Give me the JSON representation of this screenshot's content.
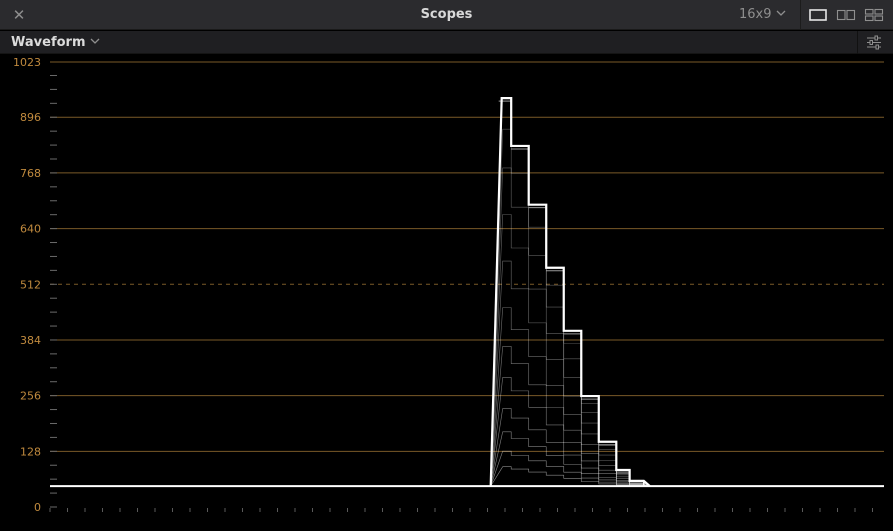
{
  "titlebar": {
    "title": "Scopes",
    "aspect_ratio": "16x9",
    "close_icon": "close-icon",
    "layout_options": [
      "single-view-icon",
      "dual-view-icon",
      "quad-view-icon"
    ]
  },
  "toolbar": {
    "scope_type": "Waveform",
    "settings_icon": "sliders-icon"
  },
  "scope": {
    "scale_labels": [
      "1023",
      "896",
      "768",
      "640",
      "512",
      "384",
      "256",
      "128",
      "0"
    ],
    "scale_values": [
      1023,
      896,
      768,
      640,
      512,
      384,
      256,
      128,
      0
    ],
    "dashed_line_value": 512,
    "baseline_level": 48,
    "trace_color": "#ffffff",
    "grid_color": "#7a5a28",
    "label_color": "#c08a3e"
  },
  "chart_data": {
    "type": "area",
    "ylim": [
      0,
      1023
    ],
    "x_fraction_range": [
      0,
      1
    ],
    "steps": [
      {
        "x_start": 0.538,
        "x_end": 0.553,
        "level": 940
      },
      {
        "x_start": 0.553,
        "x_end": 0.574,
        "level": 830
      },
      {
        "x_start": 0.574,
        "x_end": 0.595,
        "level": 695
      },
      {
        "x_start": 0.595,
        "x_end": 0.616,
        "level": 550
      },
      {
        "x_start": 0.616,
        "x_end": 0.637,
        "level": 405
      },
      {
        "x_start": 0.637,
        "x_end": 0.658,
        "level": 255
      },
      {
        "x_start": 0.658,
        "x_end": 0.679,
        "level": 150
      },
      {
        "x_start": 0.679,
        "x_end": 0.695,
        "level": 85
      },
      {
        "x_start": 0.695,
        "x_end": 0.712,
        "level": 60
      }
    ]
  }
}
